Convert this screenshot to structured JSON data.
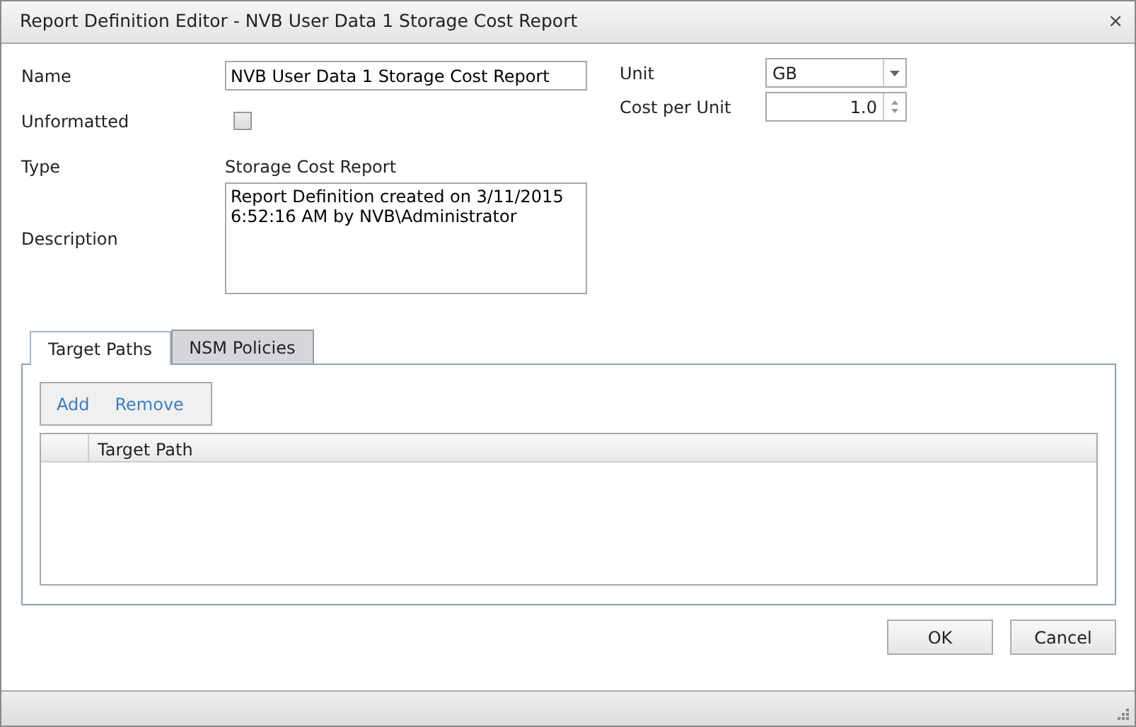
{
  "window": {
    "title": "Report Definition Editor - NVB User Data 1 Storage Cost Report",
    "close": "⨯"
  },
  "form": {
    "name_label": "Name",
    "name_value": "NVB User Data 1 Storage Cost Report",
    "unformatted_label": "Unformatted",
    "unformatted_checked": false,
    "type_label": "Type",
    "type_value": "Storage Cost Report",
    "description_label": "Description",
    "description_value": "Report Definition created on 3/11/2015 6:52:16 AM by NVB\\Administrator",
    "unit_label": "Unit",
    "unit_value": "GB",
    "cost_label": "Cost per Unit",
    "cost_value": "1.0"
  },
  "tabs": [
    {
      "label": "Target Paths",
      "selected": true
    },
    {
      "label": "NSM Policies",
      "selected": false
    }
  ],
  "toolbar": [
    "Add",
    "Remove"
  ],
  "table": {
    "columns": [
      "Target Path"
    ]
  },
  "buttons": [
    "OK",
    "Cancel"
  ]
}
